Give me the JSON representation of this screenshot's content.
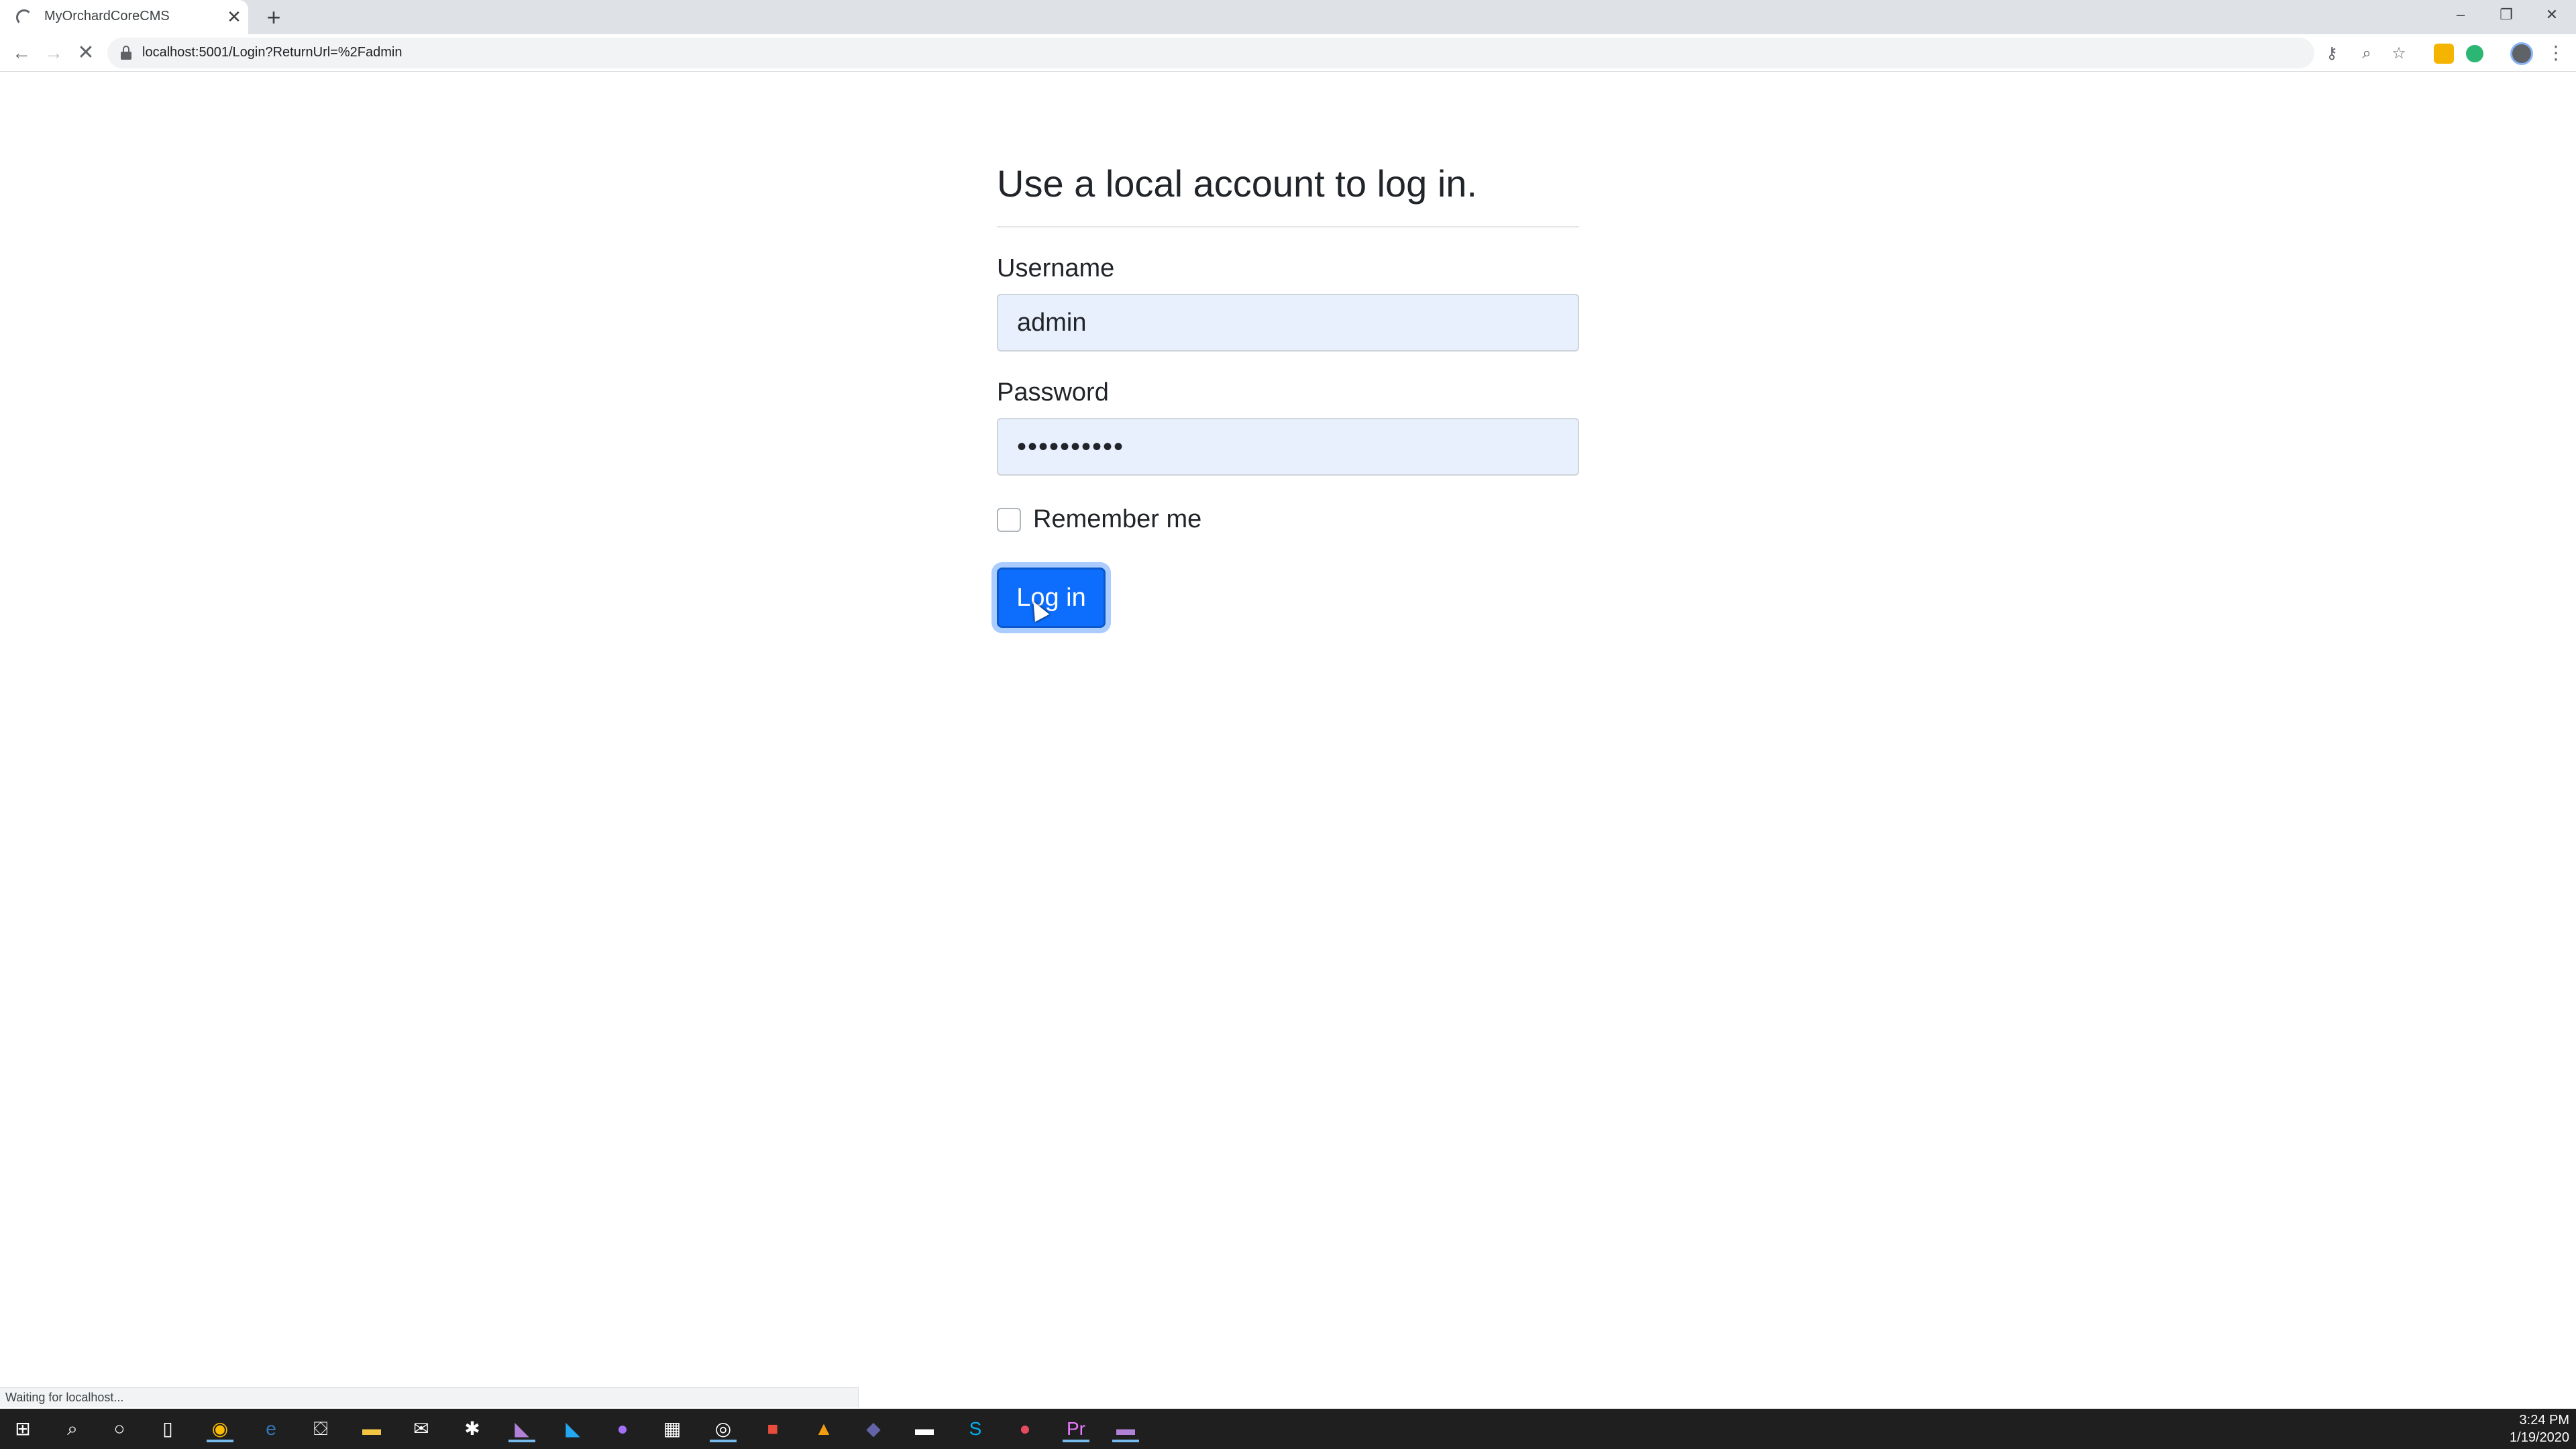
{
  "browser": {
    "tab_title": "MyOrchardCoreCMS",
    "tab_close": "✕",
    "new_tab": "+",
    "url": "localhost:5001/Login?ReturnUrl=%2Fadmin",
    "status_text": "Waiting for localhost...",
    "window_controls": {
      "minimize": "–",
      "maximize": "❐",
      "close": "✕"
    },
    "nav": {
      "back": "←",
      "forward": "→",
      "stop": "✕"
    },
    "omnibox_icons": {
      "key": "⚷",
      "zoom": "⌕",
      "star": "☆"
    },
    "menu": "⋮"
  },
  "login": {
    "heading": "Use a local account to log in.",
    "username_label": "Username",
    "username_value": "admin",
    "password_label": "Password",
    "password_value": "••••••••••",
    "remember_label": "Remember me",
    "button_label": "Log in"
  },
  "taskbar": {
    "time": "3:24 PM",
    "date": "1/19/2020",
    "icons": [
      "windows-start-icon",
      "search-icon",
      "cortana-icon",
      "task-view-icon",
      "chrome-icon",
      "edge-icon",
      "store-icon",
      "file-explorer-icon",
      "mail-icon",
      "slack-icon",
      "visual-studio-icon",
      "vscode-icon",
      "github-desktop-icon",
      "app-icon",
      "app-icon",
      "app-icon",
      "vlc-icon",
      "teams-icon",
      "terminal-icon",
      "skype-icon",
      "app-icon",
      "premiere-icon",
      "app-icon"
    ]
  },
  "colors": {
    "primary_button": "#0d6efd",
    "autofill_bg": "#e8f0fe",
    "taskbar_bg": "#1f1f1f"
  }
}
